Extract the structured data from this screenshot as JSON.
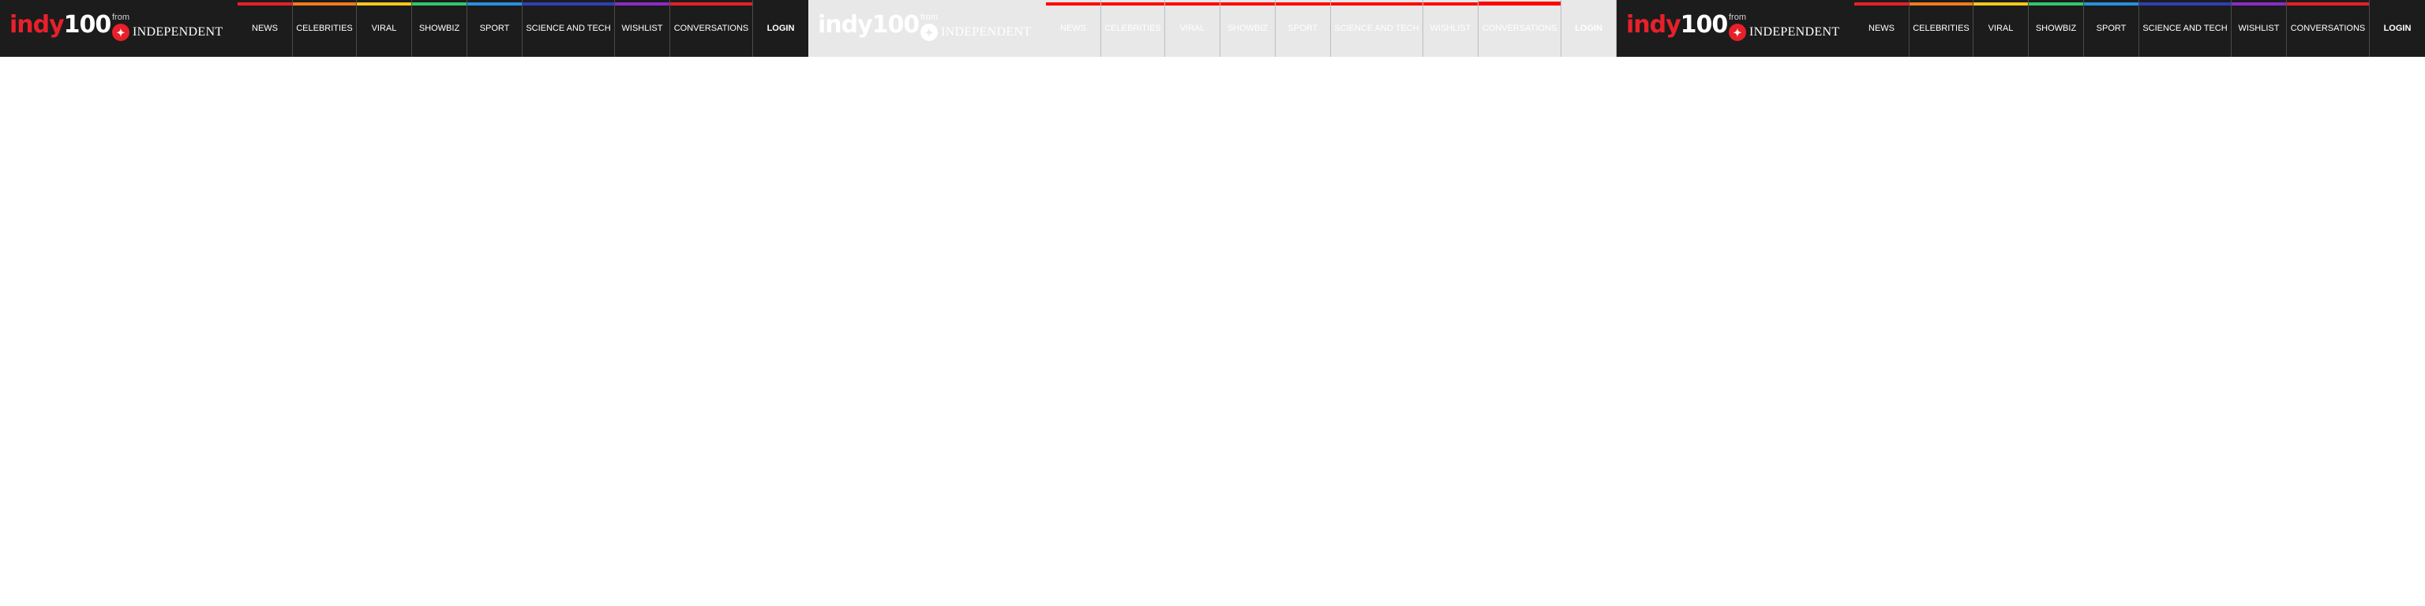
{
  "brand": {
    "logo_part1": "indy",
    "logo_part2": "100",
    "from_text": "from",
    "eagle_glyph": "✦",
    "publisher": "INDEPENDENT"
  },
  "nav": {
    "items": [
      {
        "label": "NEWS",
        "color": "#e8202a"
      },
      {
        "label": "CELEBRITIES",
        "color": "#f07c1c"
      },
      {
        "label": "VIRAL",
        "color": "#f2c81c"
      },
      {
        "label": "SHOWBIZ",
        "color": "#33c86c"
      },
      {
        "label": "SPORT",
        "color": "#2b8fdc"
      },
      {
        "label": "SCIENCE AND TECH",
        "color": "#2d3fb8"
      },
      {
        "label": "WISHLIST",
        "color": "#8a2cc8"
      },
      {
        "label": "CONVERSATIONS",
        "color": "#e8202a"
      }
    ],
    "login_label": "LOGIN"
  },
  "variant_light_bar_color": "#ff0000"
}
